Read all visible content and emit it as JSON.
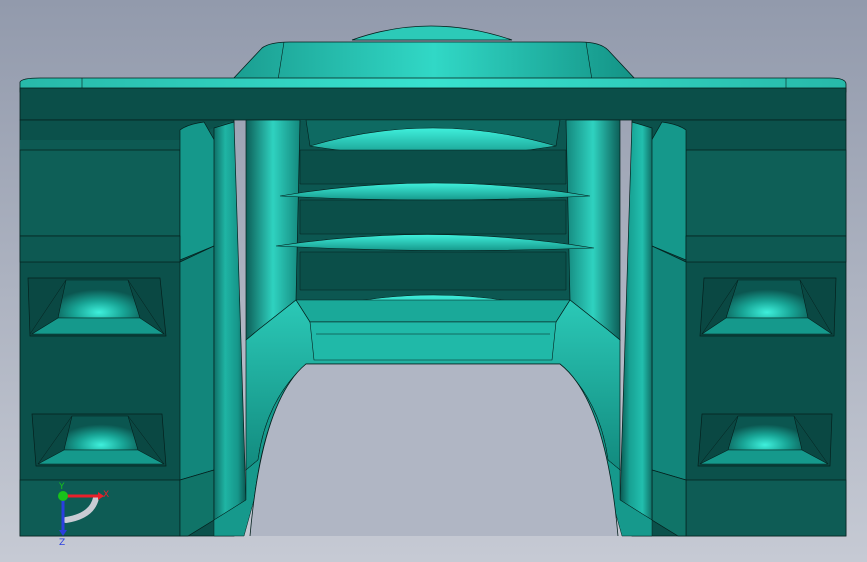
{
  "viewport": {
    "background_top": "#929aac",
    "background_bottom": "#c6cad4"
  },
  "model": {
    "shade_dark": "#0a4d47",
    "shade_mid": "#107168",
    "shade_face": "#15978b",
    "shade_light": "#2ec7b6",
    "shade_highlight": "#5ff0de",
    "edge_color": "#04201d"
  },
  "triad": {
    "x_label": "X",
    "y_label": "Y",
    "z_label": "Z",
    "x_color": "#e8202a",
    "y_color": "#18c21a",
    "z_color": "#2a3ee0"
  }
}
